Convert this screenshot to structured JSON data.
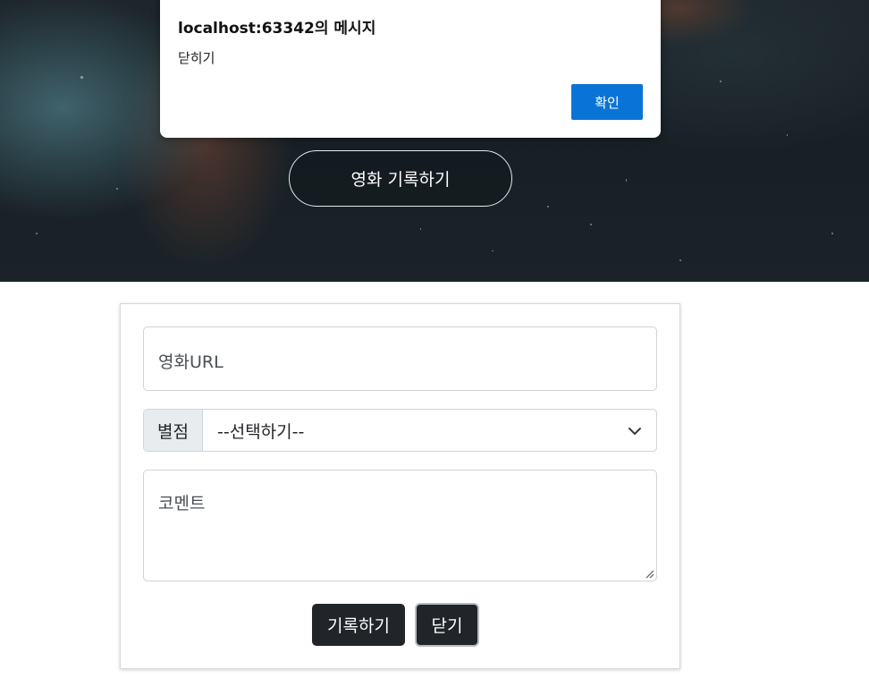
{
  "dialog": {
    "title": "localhost:63342의 메시지",
    "message": "닫히기",
    "ok_label": "확인",
    "ok_color": "#0a74d6"
  },
  "hero": {
    "record_button_label": "영화 기록하기"
  },
  "form": {
    "url_placeholder": "영화URL",
    "rating_label": "별점",
    "rating_selected": "--선택하기--",
    "comment_placeholder": "코멘트",
    "save_label": "기록하기",
    "close_label": "닫기",
    "button_color": "#212529"
  },
  "icons": {
    "select": "chevron-down-icon",
    "textarea": "resize-handle-icon"
  }
}
